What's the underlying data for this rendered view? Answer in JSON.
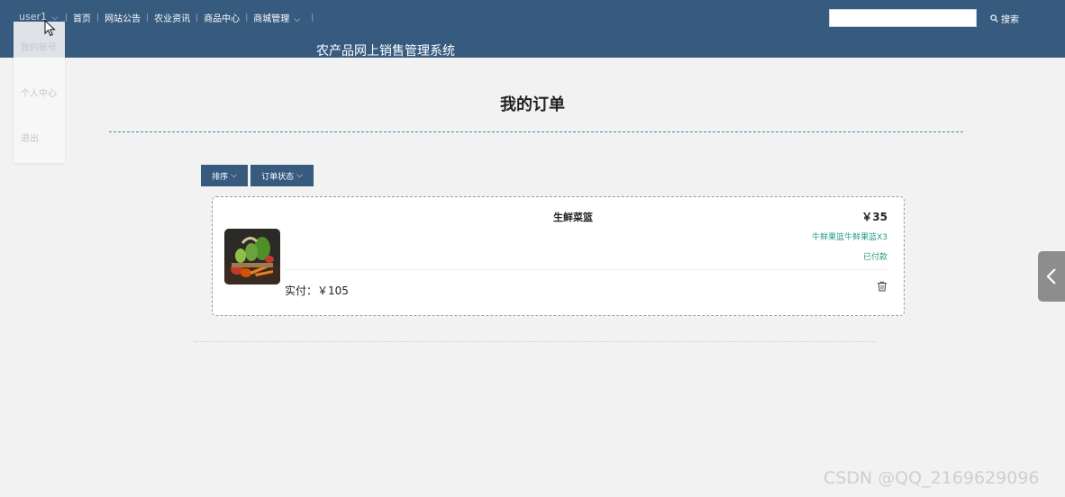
{
  "nav": {
    "user": "user1",
    "links": [
      "首页",
      "网站公告",
      "农业资讯",
      "商品中心",
      "商城管理"
    ],
    "search_button": "搜索",
    "search_placeholder": ""
  },
  "site_title": "农产品网上销售管理系统",
  "user_menu": [
    "我的账号",
    "个人中心",
    "退出"
  ],
  "page_title": "我的订单",
  "filters": {
    "sort": "排序",
    "status": "订单状态"
  },
  "order": {
    "product_name": "生鲜菜篮",
    "price": "￥35",
    "spec": "牛鲜果篮牛鲜果篮X3",
    "status": "已付款",
    "paid": "实付：￥105"
  },
  "side_tab_icon": "chevron-left-icon",
  "watermark": "CSDN @QQ_2169629096",
  "colors": {
    "brand": "#375a7f",
    "accent": "#2a9a8a"
  }
}
